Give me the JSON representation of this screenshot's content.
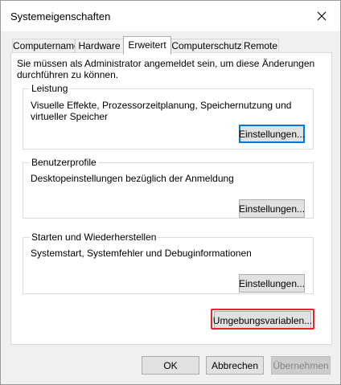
{
  "window": {
    "title": "Systemeigenschaften"
  },
  "tabs": [
    {
      "label": "Computername"
    },
    {
      "label": "Hardware"
    },
    {
      "label": "Erweitert"
    },
    {
      "label": "Computerschutz"
    },
    {
      "label": "Remote"
    }
  ],
  "active_tab": "Erweitert",
  "panel": {
    "admin_note": "Sie müssen als Administrator angemeldet sein, um diese Änderungen durchführen zu können.",
    "groups": [
      {
        "title": "Leistung",
        "description": "Visuelle Effekte, Prozessorzeitplanung, Speichernutzung und virtueller Speicher",
        "button_label": "Einstellungen..."
      },
      {
        "title": "Benutzerprofile",
        "description": "Desktopeinstellungen bezüglich der Anmeldung",
        "button_label": "Einstellungen..."
      },
      {
        "title": "Starten und Wiederherstellen",
        "description": "Systemstart, Systemfehler und Debuginformationen",
        "button_label": "Einstellungen..."
      }
    ],
    "env_button_label": "Umgebungsvariablen..."
  },
  "footer": {
    "ok_label": "OK",
    "cancel_label": "Abbrechen",
    "apply_label": "Übernehmen"
  },
  "colors": {
    "highlight": "#e8232b",
    "focus": "#0078d7"
  },
  "icons": {
    "close": "close-icon"
  }
}
